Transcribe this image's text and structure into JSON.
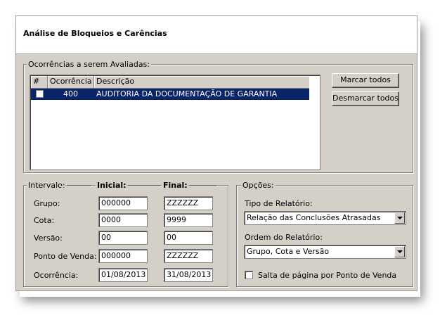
{
  "header": {
    "title": "Análise de Bloqueios e Carências"
  },
  "ocorrencias": {
    "legend": "Ocorrências a serem Avaliadas:",
    "columns": [
      "#",
      "Ocorrência",
      "Descrição"
    ],
    "rows": [
      {
        "checked": false,
        "ocorrencia": "400",
        "descricao": "AUDITORIA  DA DOCUMENTAÇÃO DE GARANTIA",
        "selected": true
      }
    ],
    "buttons": {
      "mark_all": "Marcar todos",
      "unmark_all": "Desmarcar todos"
    }
  },
  "intervalo": {
    "legend": "Intervalo:",
    "col_inicial": "Inicial:",
    "col_final": "Final:",
    "fields": [
      {
        "label": "Grupo:",
        "inicial": "000000",
        "final": "ZZZZZZ"
      },
      {
        "label": "Cota:",
        "inicial": "0000",
        "final": "9999"
      },
      {
        "label": "Versão:",
        "inicial": "00",
        "final": "00"
      },
      {
        "label": "Ponto de Venda:",
        "inicial": "000000",
        "final": "ZZZZZZ"
      },
      {
        "label": "Ocorrência:",
        "inicial": "01/08/2013",
        "final": "31/08/2013"
      }
    ]
  },
  "opcoes": {
    "legend": "Opções:",
    "tipo_label": "Tipo de Relatório:",
    "tipo_value": "Relação das Conclusões Atrasadas",
    "ordem_label": "Ordem do Relatório:",
    "ordem_value": "Grupo, Cota e Versão",
    "salta_label": "Salta de página por Ponto de Venda",
    "salta_checked": false
  },
  "colors": {
    "selection": "#0a246a",
    "face": "#d4d0c8"
  }
}
